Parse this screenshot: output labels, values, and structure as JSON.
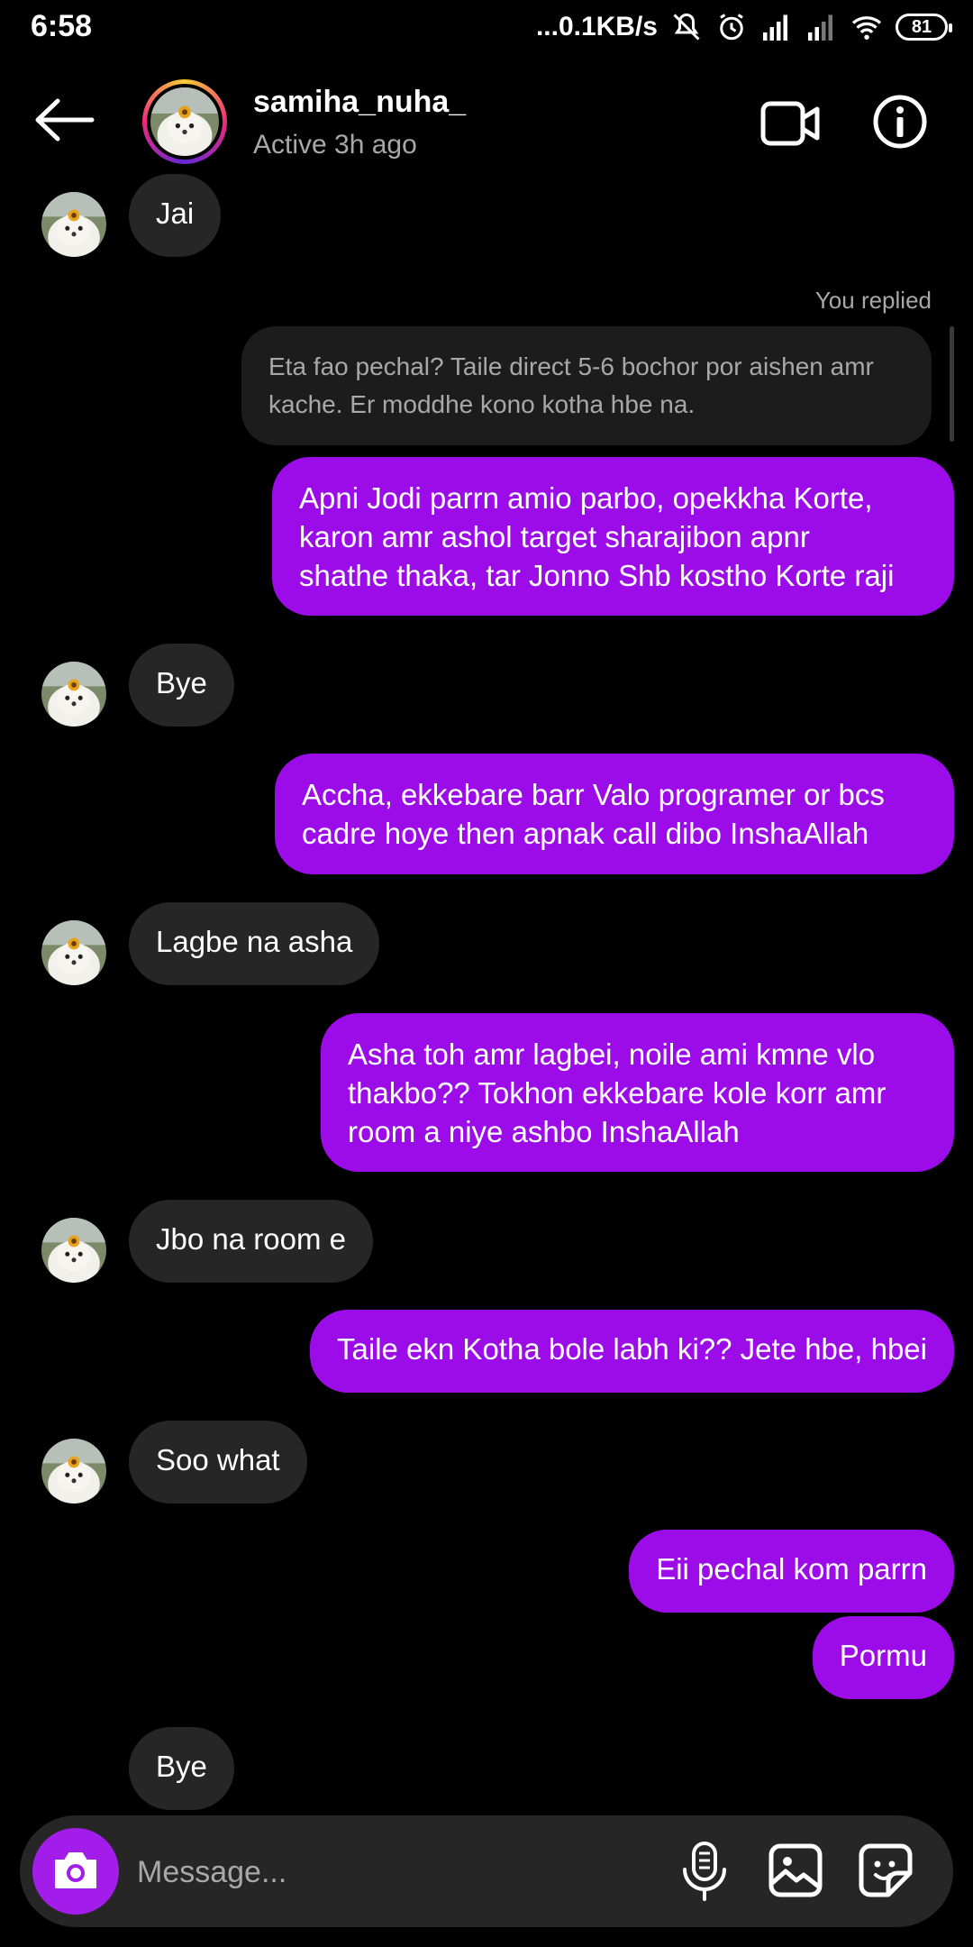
{
  "status_bar": {
    "time": "6:58",
    "network_speed": "...0.1KB/s",
    "battery": "81",
    "icons": [
      "mute-icon",
      "alarm-icon",
      "signal-icon",
      "signal-icon",
      "wifi-icon",
      "battery-icon"
    ]
  },
  "header": {
    "username": "samiha_nuha_",
    "status": "Active 3h ago",
    "icons": [
      "back-arrow-icon",
      "video-call-icon",
      "info-icon"
    ]
  },
  "messages": [
    {
      "from": "them",
      "text": "Jai"
    },
    {
      "from": "me",
      "reply_label": "You replied",
      "reply_quote": "Eta fao pechal? Taile direct 5-6 bochor por aishen amr kache. Er moddhe kono kotha hbe na.",
      "lines": [
        "Apni Jodi parrn amio parbo, opekkha Korte,",
        "karon amr ashol target sharajibon apnr",
        "shathe thaka, tar Jonno Shb kostho Korte raji"
      ]
    },
    {
      "from": "them",
      "text": "Bye"
    },
    {
      "from": "me",
      "lines": [
        "Accha, ekkebare barr Valo programer or bcs",
        "cadre hoye then apnak call dibo InshaAllah"
      ]
    },
    {
      "from": "them",
      "text": "Lagbe na asha"
    },
    {
      "from": "me",
      "lines": [
        "Asha toh amr lagbei, noile ami kmne vlo",
        "thakbo?? Tokhon ekkebare kole korr amr",
        "room a niye ashbo InshaAllah"
      ]
    },
    {
      "from": "them",
      "text": "Jbo na room e"
    },
    {
      "from": "me",
      "text": "Taile ekn Kotha bole labh ki?? Jete hbe, hbei"
    },
    {
      "from": "them",
      "text": "Soo what"
    },
    {
      "from": "me",
      "text": "Eii pechal kom parrn"
    },
    {
      "from": "me",
      "text": "Pormu"
    },
    {
      "from": "them",
      "text": "Bye"
    }
  ],
  "composer": {
    "placeholder": "Message...",
    "icons": [
      "camera-icon",
      "microphone-icon",
      "gallery-icon",
      "sticker-icon"
    ]
  },
  "colors": {
    "background": "#000000",
    "incoming_bubble": "#262626",
    "outgoing_bubble": "#9c0ce8",
    "secondary_text": "#a8a8a8"
  }
}
